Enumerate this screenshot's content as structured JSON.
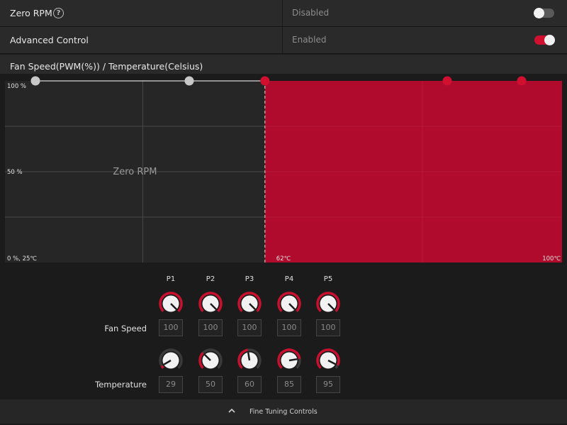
{
  "zero_rpm": {
    "label": "Zero RPM",
    "help": "?",
    "value": "Disabled",
    "toggle_on": false
  },
  "advanced_control": {
    "label": "Advanced Control",
    "value": "Enabled",
    "toggle_on": true
  },
  "chart_title": "Fan Speed(PWM(%)) / Temperature(Celsius)",
  "chart_data": {
    "type": "area",
    "y_labels": [
      "100 %",
      "50 %",
      "0 %, 25℃"
    ],
    "x_labels": [
      "62℃",
      "100℃"
    ],
    "zero_rpm_label": "Zero RPM",
    "xlim": [
      25,
      100
    ],
    "ylim": [
      0,
      100
    ],
    "points": [
      {
        "x": 29,
        "y": 100,
        "active": false
      },
      {
        "x": 50,
        "y": 100,
        "active": false
      },
      {
        "x": 60,
        "y": 100,
        "active": true
      },
      {
        "x": 85,
        "y": 100,
        "active": true
      },
      {
        "x": 95,
        "y": 100,
        "active": true
      }
    ],
    "zero_rpm_until": 60,
    "accent": "#b00a2c",
    "point_active_color": "#d1102f",
    "point_inactive_color": "#c8c8c8"
  },
  "params": {
    "columns": [
      "P1",
      "P2",
      "P3",
      "P4",
      "P5"
    ],
    "fan_speed_label": "Fan Speed",
    "temperature_label": "Temperature",
    "fan_speed": [
      100,
      100,
      100,
      100,
      100
    ],
    "temperature": [
      29,
      50,
      60,
      85,
      95
    ],
    "temperature_range": [
      25,
      100
    ]
  },
  "footer": {
    "label": "Fine Tuning Controls"
  }
}
